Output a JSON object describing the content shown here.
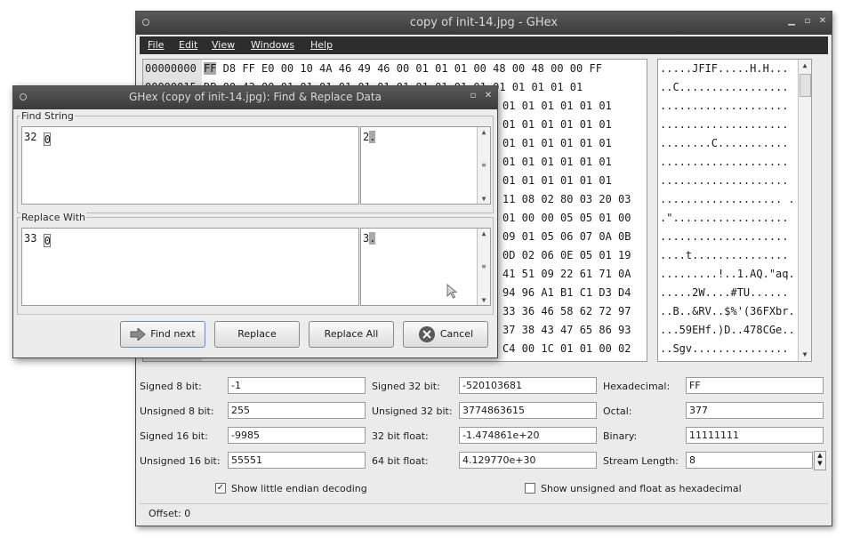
{
  "main_window": {
    "title": "copy of init-14.jpg - GHex",
    "menu": [
      "File",
      "Edit",
      "View",
      "Windows",
      "Help"
    ]
  },
  "hex_view": {
    "offsets": [
      "00000000",
      "00000015"
    ],
    "first_byte": "FF",
    "rows": [
      " D8 FF E0 00 10 4A 46 49 46 00 01 01 01 00 48 00 48 00 00 FF",
      "DB 00 43 00 01 01 01 01 01 01 01 01 01 01 01 01 01 01 01 01",
      "01 01 01 01 01 01",
      "01 01 01 01 01 01",
      "01 01 01 01 01 01",
      "01 01 01 01 01 01",
      "01 01 01 01 01 01",
      "11 08 02 80 03 20 03",
      "01 00 00 05 05 01 00",
      "09 01 05 06 07 0A 0B",
      "0D 02 06 0E 05 01 19",
      "41 51 09 22 61 71 0A",
      "94 96 A1 B1 C1 D3 D4",
      "33 36 46 58 62 72 97",
      "37 38 43 47 65 86 93",
      "C4 00 1C 01 01 00 02"
    ],
    "ascii_rows": [
      ".....JFIF.....H.H...",
      "..C.................",
      "....................",
      "....................",
      "........C...........",
      "....................",
      "....................",
      "................... .",
      ".\"..................",
      "....................",
      "....t...............",
      ".........!..1.AQ.\"aq.",
      ".....2W....#TU......",
      "..B..&RV..$%'(36FXbr.",
      "...59EHf.)D..478CGe..",
      "..Sgv..............."
    ]
  },
  "values": {
    "signed_8_label": "Signed 8 bit:",
    "signed_8": "-1",
    "unsigned_8_label": "Unsigned 8 bit:",
    "unsigned_8": "255",
    "signed_16_label": "Signed 16 bit:",
    "signed_16": "-9985",
    "unsigned_16_label": "Unsigned 16 bit:",
    "unsigned_16": "55551",
    "signed_32_label": "Signed 32 bit:",
    "signed_32": "-520103681",
    "unsigned_32_label": "Unsigned 32 bit:",
    "unsigned_32": "3774863615",
    "float_32_label": "32 bit float:",
    "float_32": "-1.474861e+20",
    "float_64_label": "64 bit float:",
    "float_64": "4.129770e+30",
    "hex_label": "Hexadecimal:",
    "hex": "FF",
    "octal_label": "Octal:",
    "octal": "377",
    "binary_label": "Binary:",
    "binary": "11111111",
    "stream_label": "Stream Length:",
    "stream": "8"
  },
  "options": {
    "little_endian_label": "Show little endian decoding",
    "little_endian_checked": true,
    "unsigned_hex_label": "Show unsigned and float as hexadecimal",
    "unsigned_hex_checked": false
  },
  "status": {
    "offset": "Offset: 0"
  },
  "dialog": {
    "title": "GHex (copy of init-14.jpg): Find & Replace Data",
    "find_label": "Find String",
    "find_hex": "32 0",
    "find_ascii": "2.",
    "replace_label": "Replace With",
    "replace_hex": "33 0",
    "replace_ascii": "3.",
    "buttons": {
      "find_next": "Find next",
      "replace": "Replace",
      "replace_all": "Replace All",
      "cancel": "Cancel"
    }
  },
  "icons": [
    "arrow-right-icon",
    "cancel-icon",
    "window-menu-icon",
    "minimize-icon",
    "maximize-icon",
    "close-icon"
  ]
}
